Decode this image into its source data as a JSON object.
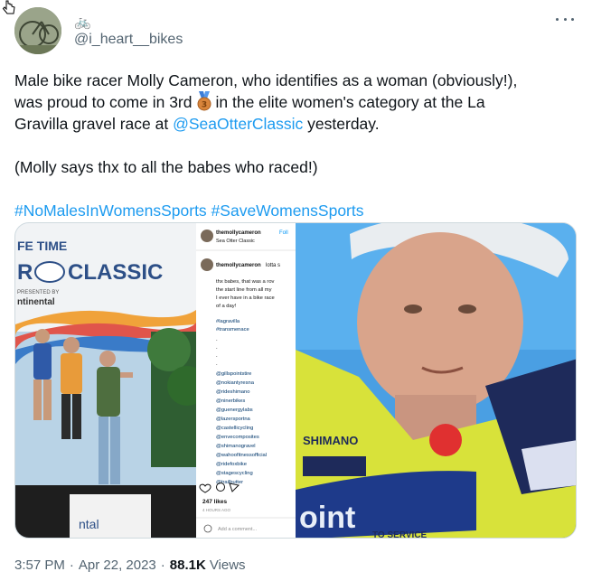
{
  "author": {
    "display_name": "🚲",
    "handle": "@i_heart__bikes"
  },
  "tweet": {
    "line1": "Male bike racer Molly Cameron, who identifies as a woman (obviously!),",
    "line2_a": "was proud to come in 3rd",
    "line2_b": "in the elite women's category at the La",
    "line3_a": "Gravilla gravel race at",
    "mention": "@SeaOtterClassic",
    "line3_b": "yesterday.",
    "paragraph2": "(Molly says thx to all the babes who raced!)",
    "hashtag1": "#NoMalesInWomensSports",
    "hashtag2": "#SaveWomensSports",
    "medal_number": "3"
  },
  "media": {
    "banner_line1": "FE TIME",
    "banner_line2": "R",
    "banner_classic": "CLASSIC",
    "banner_presented": "PRESENTED BY",
    "banner_sponsor": "ntinental",
    "banner_bottom": "ntal",
    "ig_user": "themollycameron",
    "ig_follow": "Foll",
    "ig_location": "Sea Otter Classic",
    "ig_caption_user": "themollycameron",
    "ig_caption_tail": "lotta s",
    "ig_caption_lines": [
      "thx babes, that was a rov",
      "the start line from all my",
      "I ever have in a bike race",
      "of a day!"
    ],
    "ig_tags": [
      "#lagravilla",
      "#transmenace"
    ],
    "ig_mentions": [
      "@gillspointstire",
      "@nokiantyresna",
      "@rideshimano",
      "@ninerbikes",
      "@guenergylabs",
      "@lazersportna",
      "@castellicycling",
      "@envecomposites",
      "@shimanogravel",
      "@wahoofitnessofficial",
      "@ridefoxbike",
      "@stagescycling",
      "@trailbutter"
    ],
    "ig_likes": "247 likes",
    "ig_time": "4 HOURS AGO",
    "ig_comment_placeholder": "Add a comment...",
    "jersey_brand": "SHIMANO",
    "jersey_big": "oint",
    "jersey_service": "TO SERVICE"
  },
  "footer": {
    "time": "3:57 PM",
    "date": "Apr 22, 2023",
    "views_count": "88.1K",
    "views_label": "Views"
  },
  "colors": {
    "link": "#1d9bf0",
    "text": "#0f1419",
    "muted": "#536471"
  }
}
